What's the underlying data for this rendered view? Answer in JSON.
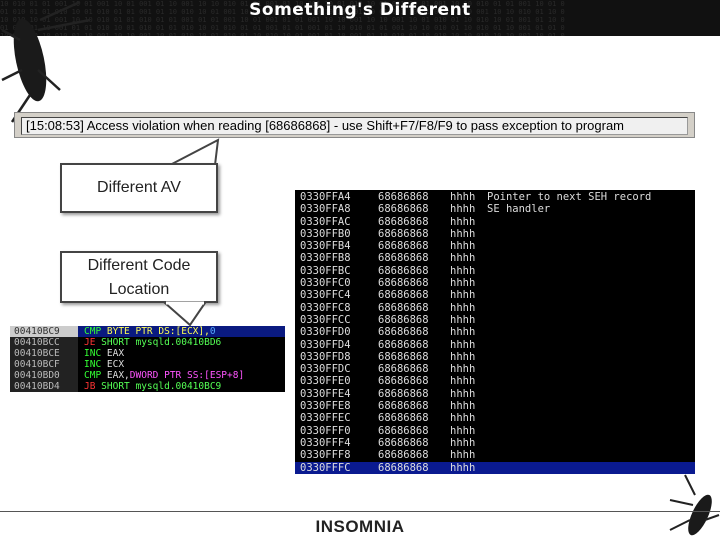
{
  "title": "Something's Different",
  "status_bar": "[15:08:53] Access violation when reading [68686868] - use Shift+F7/F8/F9 to pass exception to program",
  "callouts": {
    "av": "Different AV",
    "code": "Different Code Location"
  },
  "disasm": [
    {
      "addr": "00410BC9",
      "op": "CMP",
      "opc": "#33ff33",
      "args": [
        {
          "t": "BYTE PTR DS:[ECX],",
          "c": "#ffff55"
        },
        {
          "t": "0",
          "c": "#55aaff"
        }
      ]
    },
    {
      "addr": "00410BCC",
      "op": "JE",
      "opc": "#ff3333",
      "args": [
        {
          "t": "SHORT mysqld.00410BD6",
          "c": "#55ff55"
        }
      ]
    },
    {
      "addr": "00410BCE",
      "op": "INC",
      "opc": "#33ff33",
      "args": [
        {
          "t": "EAX",
          "c": "#dddddd"
        }
      ]
    },
    {
      "addr": "00410BCF",
      "op": "INC",
      "opc": "#33ff33",
      "args": [
        {
          "t": "ECX",
          "c": "#dddddd"
        }
      ]
    },
    {
      "addr": "00410BD0",
      "op": "CMP",
      "opc": "#33ff33",
      "args": [
        {
          "t": "EAX,",
          "c": "#dddddd"
        },
        {
          "t": "DWORD PTR SS:[ESP+8]",
          "c": "#ff55ff"
        }
      ]
    },
    {
      "addr": "00410BD4",
      "op": "JB",
      "opc": "#ff3333",
      "args": [
        {
          "t": "SHORT mysqld.00410BC9",
          "c": "#55ff55"
        }
      ]
    }
  ],
  "stack": [
    {
      "addr": "0330FFA4",
      "val": "68686868",
      "ascii": "hhhh",
      "comment": "Pointer to next SEH record"
    },
    {
      "addr": "0330FFA8",
      "val": "68686868",
      "ascii": "hhhh",
      "comment": "SE handler"
    },
    {
      "addr": "0330FFAC",
      "val": "68686868",
      "ascii": "hhhh",
      "comment": ""
    },
    {
      "addr": "0330FFB0",
      "val": "68686868",
      "ascii": "hhhh",
      "comment": ""
    },
    {
      "addr": "0330FFB4",
      "val": "68686868",
      "ascii": "hhhh",
      "comment": ""
    },
    {
      "addr": "0330FFB8",
      "val": "68686868",
      "ascii": "hhhh",
      "comment": ""
    },
    {
      "addr": "0330FFBC",
      "val": "68686868",
      "ascii": "hhhh",
      "comment": ""
    },
    {
      "addr": "0330FFC0",
      "val": "68686868",
      "ascii": "hhhh",
      "comment": ""
    },
    {
      "addr": "0330FFC4",
      "val": "68686868",
      "ascii": "hhhh",
      "comment": ""
    },
    {
      "addr": "0330FFC8",
      "val": "68686868",
      "ascii": "hhhh",
      "comment": ""
    },
    {
      "addr": "0330FFCC",
      "val": "68686868",
      "ascii": "hhhh",
      "comment": ""
    },
    {
      "addr": "0330FFD0",
      "val": "68686868",
      "ascii": "hhhh",
      "comment": ""
    },
    {
      "addr": "0330FFD4",
      "val": "68686868",
      "ascii": "hhhh",
      "comment": ""
    },
    {
      "addr": "0330FFD8",
      "val": "68686868",
      "ascii": "hhhh",
      "comment": ""
    },
    {
      "addr": "0330FFDC",
      "val": "68686868",
      "ascii": "hhhh",
      "comment": ""
    },
    {
      "addr": "0330FFE0",
      "val": "68686868",
      "ascii": "hhhh",
      "comment": ""
    },
    {
      "addr": "0330FFE4",
      "val": "68686868",
      "ascii": "hhhh",
      "comment": ""
    },
    {
      "addr": "0330FFE8",
      "val": "68686868",
      "ascii": "hhhh",
      "comment": ""
    },
    {
      "addr": "0330FFEC",
      "val": "68686868",
      "ascii": "hhhh",
      "comment": ""
    },
    {
      "addr": "0330FFF0",
      "val": "68686868",
      "ascii": "hhhh",
      "comment": ""
    },
    {
      "addr": "0330FFF4",
      "val": "68686868",
      "ascii": "hhhh",
      "comment": ""
    },
    {
      "addr": "0330FFF8",
      "val": "68686868",
      "ascii": "hhhh",
      "comment": ""
    },
    {
      "addr": "0330FFFC",
      "val": "68686868",
      "ascii": "hhhh",
      "comment": ""
    }
  ],
  "footer_logo": "INSOMNIA"
}
